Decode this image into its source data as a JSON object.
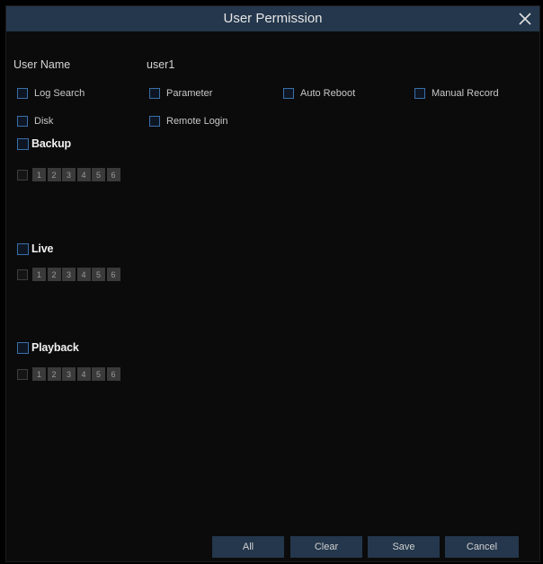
{
  "dialog": {
    "title": "User Permission",
    "close_icon": "close-icon"
  },
  "user": {
    "name_label": "User Name",
    "name_value": "user1"
  },
  "permissions": [
    {
      "label": "Log Search",
      "checked": false
    },
    {
      "label": "Parameter",
      "checked": false
    },
    {
      "label": "Auto Reboot",
      "checked": false
    },
    {
      "label": "Manual Record",
      "checked": false
    },
    {
      "label": "Disk",
      "checked": false
    },
    {
      "label": "Remote Login",
      "checked": false
    }
  ],
  "sections": [
    {
      "label": "Backup",
      "checked": false,
      "channels": [
        "1",
        "2",
        "3",
        "4",
        "5",
        "6"
      ]
    },
    {
      "label": "Live",
      "checked": false,
      "channels": [
        "1",
        "2",
        "3",
        "4",
        "5",
        "6"
      ]
    },
    {
      "label": "Playback",
      "checked": false,
      "channels": [
        "1",
        "2",
        "3",
        "4",
        "5",
        "6"
      ]
    }
  ],
  "buttons": {
    "all": "All",
    "clear": "Clear",
    "save": "Save",
    "cancel": "Cancel"
  },
  "colors": {
    "titlebar": "#24374c",
    "checkbox_border": "#3a6fa8",
    "background": "#0b0b0b"
  }
}
